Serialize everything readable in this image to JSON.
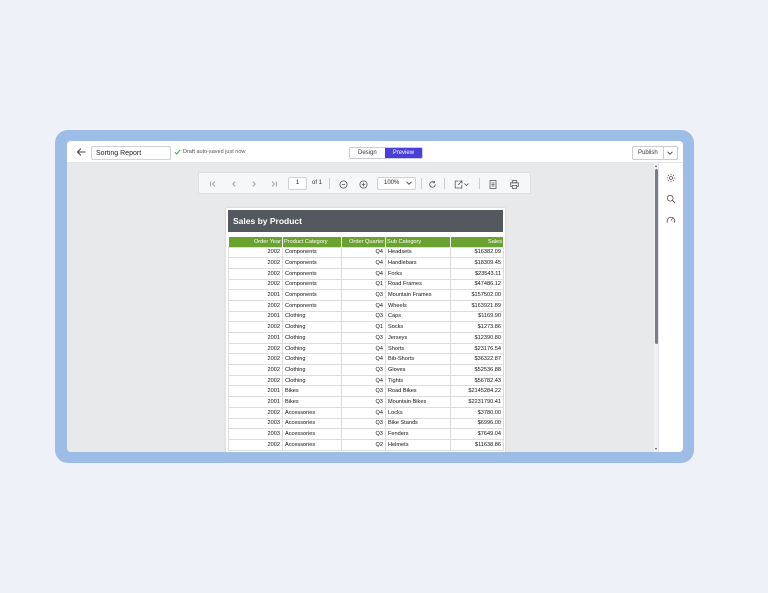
{
  "colors": {
    "background": "#eef2f8",
    "frame": "#9dbde6",
    "accent": "#4a3ed9",
    "table_header": "#6aa230",
    "report_header": "#545960"
  },
  "topbar": {
    "report_name": "Sorting Report",
    "autosave_text": "Draft auto-saved just now",
    "tabs": [
      "Design",
      "Preview"
    ],
    "active_tab": "Preview",
    "publish_label": "Publish"
  },
  "toolbar": {
    "page_number": "1",
    "page_of": "of 1",
    "zoom": "100%"
  },
  "report": {
    "title": "Sales by Product",
    "columns": [
      "Order Year",
      "Product Category",
      "Order Quarter",
      "Sub Category",
      "Sales"
    ],
    "rows": [
      [
        "2002",
        "Components",
        "Q4",
        "Headsets",
        "$16382.09"
      ],
      [
        "2002",
        "Components",
        "Q4",
        "Handlebars",
        "$18309.45"
      ],
      [
        "2002",
        "Components",
        "Q4",
        "Forks",
        "$23543.11"
      ],
      [
        "2002",
        "Components",
        "Q1",
        "Road Frames",
        "$47486.12"
      ],
      [
        "2001",
        "Components",
        "Q3",
        "Mountain Frames",
        "$157502.00"
      ],
      [
        "2002",
        "Components",
        "Q4",
        "Wheels",
        "$163921.89"
      ],
      [
        "2001",
        "Clothing",
        "Q3",
        "Caps",
        "$1169.90"
      ],
      [
        "2002",
        "Clothing",
        "Q1",
        "Socks",
        "$1273.86"
      ],
      [
        "2001",
        "Clothing",
        "Q3",
        "Jerseys",
        "$12390.80"
      ],
      [
        "2002",
        "Clothing",
        "Q4",
        "Shorts",
        "$23176.54"
      ],
      [
        "2002",
        "Clothing",
        "Q4",
        "Bib-Shorts",
        "$36322.87"
      ],
      [
        "2002",
        "Clothing",
        "Q3",
        "Gloves",
        "$52536.88"
      ],
      [
        "2002",
        "Clothing",
        "Q4",
        "Tights",
        "$56782.43"
      ],
      [
        "2001",
        "Bikes",
        "Q3",
        "Road Bikes",
        "$2145284.22"
      ],
      [
        "2001",
        "Bikes",
        "Q3",
        "Mountain Bikes",
        "$2231790.41"
      ],
      [
        "2002",
        "Accessories",
        "Q4",
        "Locks",
        "$3780.00"
      ],
      [
        "2003",
        "Accessories",
        "Q3",
        "Bike Stands",
        "$6996.00"
      ],
      [
        "2003",
        "Accessories",
        "Q3",
        "Fenders",
        "$7649.04"
      ],
      [
        "2002",
        "Accessories",
        "Q2",
        "Helmets",
        "$11638.86"
      ]
    ]
  },
  "icons": {
    "back": "arrow-left-icon",
    "check": "check-icon",
    "publish_menu": "chevron-down-icon",
    "first": "first-page-icon",
    "prev": "prev-page-icon",
    "next": "next-page-icon",
    "last": "last-page-icon",
    "zoom_out": "zoom-out-icon",
    "zoom_in": "zoom-in-icon",
    "refresh": "refresh-icon",
    "export": "export-icon",
    "parameters": "document-icon",
    "print": "print-icon",
    "settings": "gear-icon",
    "search": "search-icon",
    "gauge": "gauge-icon"
  }
}
